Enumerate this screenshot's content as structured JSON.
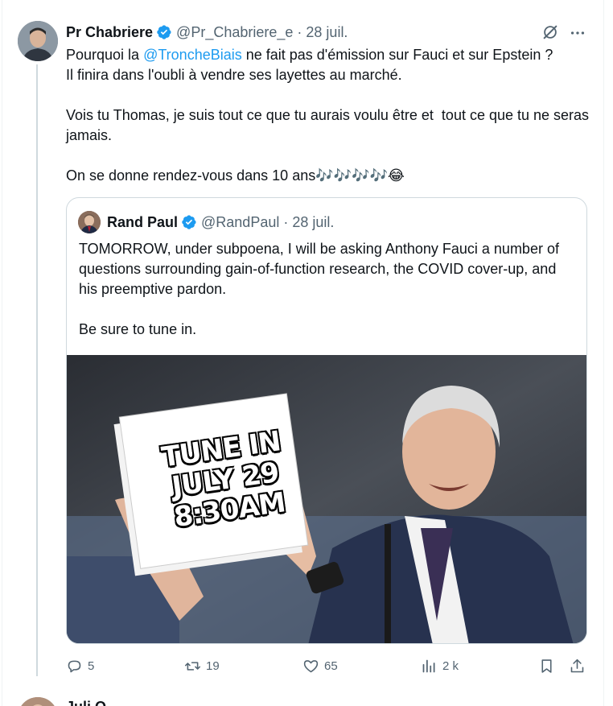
{
  "tweet": {
    "author_name": "Pr Chabriere",
    "author_handle": "@Pr_Chabriere_e",
    "separator": "·",
    "date": "28 juil.",
    "text_before_mention": "Pourquoi la ",
    "mention": "@TroncheBiais",
    "text_after_mention": " ne fait pas d'émission sur Fauci et sur Epstein ?\nIl finira dans l'oubli à vendre ses layettes au marché.\n\nVois tu Thomas, je suis tout ce que tu aurais voulu être et  tout ce que tu ne seras jamais.\n\nOn se donne rendez-vous dans 10 ans🎶🎶🎶🎶😂"
  },
  "quote": {
    "author_name": "Rand Paul",
    "author_handle": "@RandPaul",
    "separator": "·",
    "date": "28 juil.",
    "text": "TOMORROW, under subpoena, I will be asking Anthony Fauci a number of questions surrounding gain-of-function research, the COVID cover-up, and his preemptive pardon.\n\nBe sure to tune in.",
    "image_sign_lines": [
      "TUNE IN",
      "JULY 29",
      "8:30AM"
    ]
  },
  "actions": {
    "replies": "5",
    "retweets": "19",
    "likes": "65",
    "views": "2 k"
  },
  "next_tweet": {
    "author_name": "Juli Q"
  },
  "colors": {
    "accent": "#1d9bf0",
    "text_primary": "#0f1419",
    "text_secondary": "#536471",
    "border": "#cfd9de"
  },
  "icons": {
    "verified": "verified-badge-icon",
    "grok": "grok-icon",
    "more": "more-icon",
    "reply": "reply-icon",
    "retweet": "retweet-icon",
    "like": "heart-icon",
    "views": "views-icon",
    "bookmark": "bookmark-icon",
    "share": "share-icon"
  }
}
